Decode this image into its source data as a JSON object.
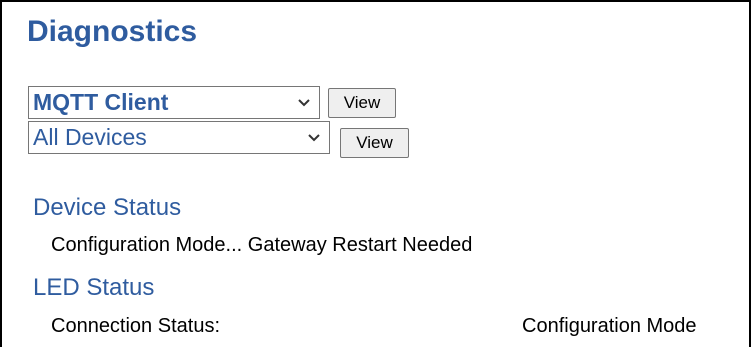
{
  "page": {
    "title": "Diagnostics"
  },
  "controls": {
    "selects": [
      {
        "selected": "MQTT Client"
      },
      {
        "selected": "All Devices"
      }
    ],
    "view_button_label": "View"
  },
  "device_status": {
    "heading": "Device Status",
    "line": "Configuration Mode... Gateway Restart Needed"
  },
  "led_status": {
    "heading": "LED Status",
    "rows": [
      {
        "label": "Connection Status:",
        "value": "Configuration Mode"
      }
    ]
  },
  "colors": {
    "heading": "#2f5c9f",
    "text": "#000000",
    "button_bg": "#efefef",
    "frame": "#000000"
  },
  "icons": {
    "select_arrow": "chevron-down-icon"
  }
}
